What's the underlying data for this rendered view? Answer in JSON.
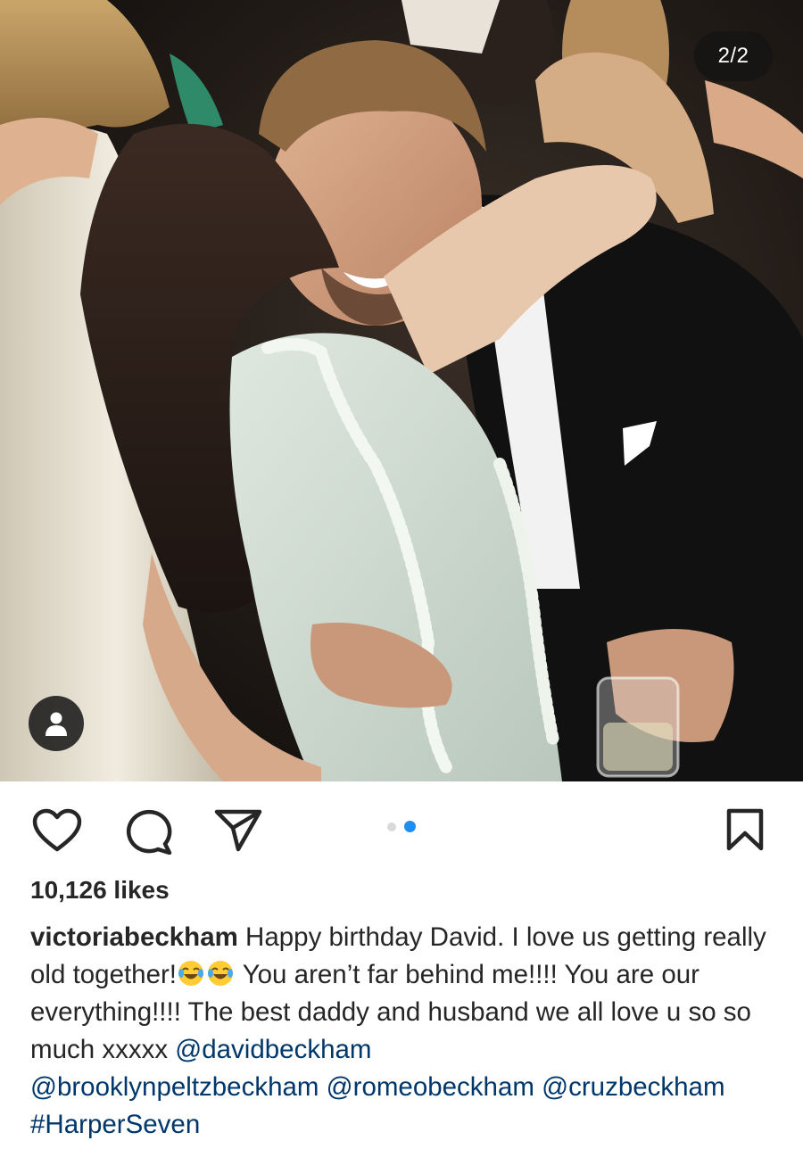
{
  "post": {
    "image_counter": "2/2",
    "image_alt": "A man in a black suit hugging a woman in a pale ruffled dress at a party",
    "likes": "10,126 likes",
    "caption": {
      "username": "victoriabeckham",
      "line1_text": "Happy birthday David. I love us getting",
      "line2_text_a": "really old together!",
      "line2_text_b": "You aren’t far behind me!!!! You are",
      "line3_text": "our everything!!!! The best daddy and husband we all love u",
      "line4_text": "so so much xxxxx",
      "mention_david": "@davidbeckham",
      "mention_brooklyn": "@brooklynpeltzbeckham",
      "mention_romeo": "@romeobeckham",
      "mention_cruz": "@cruzbeckham",
      "hashtag": "#HarperSeven"
    },
    "carousel": {
      "total": 2,
      "active": 2
    }
  },
  "icons": {
    "like": "heart-icon",
    "comment": "speech-bubble-icon",
    "share": "paper-plane-icon",
    "save": "bookmark-icon",
    "tags": "person-icon",
    "emoji": "face-with-tears-of-joy-icon"
  },
  "colors": {
    "text": "#262626",
    "link": "#00376b",
    "active_dot": "#1f8ef1",
    "inactive_dot": "#d9d9d9"
  }
}
